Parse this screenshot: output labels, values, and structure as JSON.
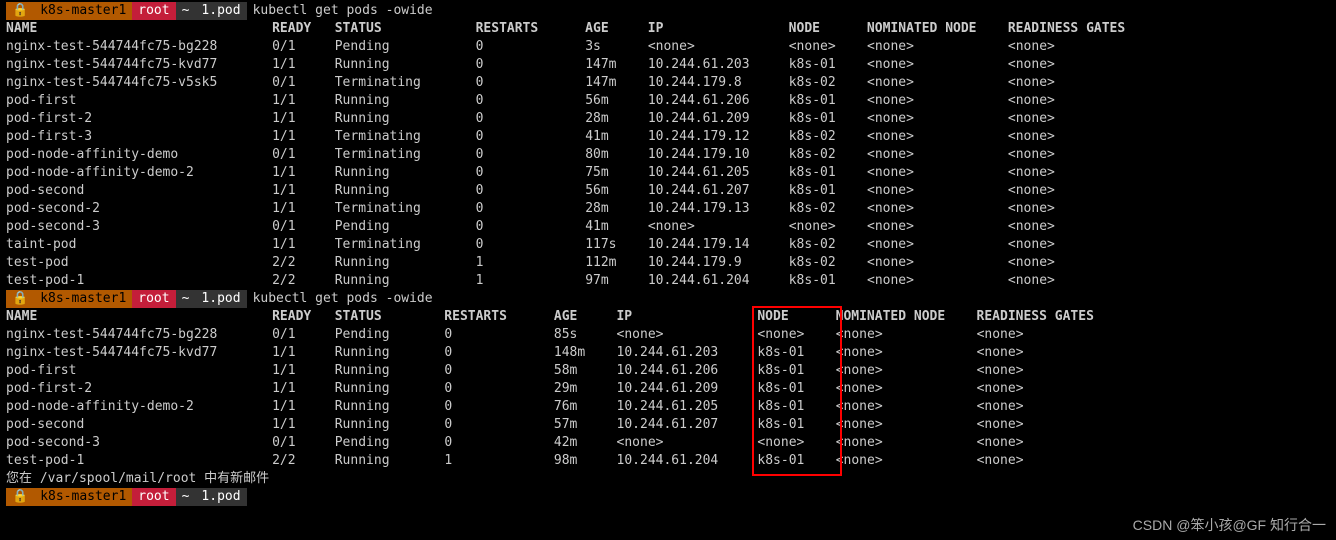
{
  "prompt": {
    "lock": "🔒",
    "host": "k8s-master1",
    "user": "root",
    "path": "~",
    "dir": "1.pod",
    "sep": "",
    "rsep": ""
  },
  "cmd1": "kubectl get pods -owide",
  "cmd2": "kubectl get pods -owide",
  "mail_msg": "您在 /var/spool/mail/root 中有新邮件",
  "cols1": {
    "w": [
      34,
      8,
      18,
      14,
      8,
      18,
      10,
      18,
      18
    ],
    "h": [
      "NAME",
      "READY",
      "STATUS",
      "RESTARTS",
      "AGE",
      "IP",
      "NODE",
      "NOMINATED NODE",
      "READINESS GATES"
    ]
  },
  "rows1": [
    [
      "nginx-test-544744fc75-bg228",
      "0/1",
      "Pending",
      "0",
      "3s",
      "<none>",
      "<none>",
      "<none>",
      "<none>"
    ],
    [
      "nginx-test-544744fc75-kvd77",
      "1/1",
      "Running",
      "0",
      "147m",
      "10.244.61.203",
      "k8s-01",
      "<none>",
      "<none>"
    ],
    [
      "nginx-test-544744fc75-v5sk5",
      "0/1",
      "Terminating",
      "0",
      "147m",
      "10.244.179.8",
      "k8s-02",
      "<none>",
      "<none>"
    ],
    [
      "pod-first",
      "1/1",
      "Running",
      "0",
      "56m",
      "10.244.61.206",
      "k8s-01",
      "<none>",
      "<none>"
    ],
    [
      "pod-first-2",
      "1/1",
      "Running",
      "0",
      "28m",
      "10.244.61.209",
      "k8s-01",
      "<none>",
      "<none>"
    ],
    [
      "pod-first-3",
      "1/1",
      "Terminating",
      "0",
      "41m",
      "10.244.179.12",
      "k8s-02",
      "<none>",
      "<none>"
    ],
    [
      "pod-node-affinity-demo",
      "0/1",
      "Terminating",
      "0",
      "80m",
      "10.244.179.10",
      "k8s-02",
      "<none>",
      "<none>"
    ],
    [
      "pod-node-affinity-demo-2",
      "1/1",
      "Running",
      "0",
      "75m",
      "10.244.61.205",
      "k8s-01",
      "<none>",
      "<none>"
    ],
    [
      "pod-second",
      "1/1",
      "Running",
      "0",
      "56m",
      "10.244.61.207",
      "k8s-01",
      "<none>",
      "<none>"
    ],
    [
      "pod-second-2",
      "1/1",
      "Terminating",
      "0",
      "28m",
      "10.244.179.13",
      "k8s-02",
      "<none>",
      "<none>"
    ],
    [
      "pod-second-3",
      "0/1",
      "Pending",
      "0",
      "41m",
      "<none>",
      "<none>",
      "<none>",
      "<none>"
    ],
    [
      "taint-pod",
      "1/1",
      "Terminating",
      "0",
      "117s",
      "10.244.179.14",
      "k8s-02",
      "<none>",
      "<none>"
    ],
    [
      "test-pod",
      "2/2",
      "Running",
      "1",
      "112m",
      "10.244.179.9",
      "k8s-02",
      "<none>",
      "<none>"
    ],
    [
      "test-pod-1",
      "2/2",
      "Running",
      "1",
      "97m",
      "10.244.61.204",
      "k8s-01",
      "<none>",
      "<none>"
    ]
  ],
  "cols2": {
    "w": [
      34,
      8,
      14,
      14,
      8,
      18,
      10,
      18,
      18
    ],
    "h": [
      "NAME",
      "READY",
      "STATUS",
      "RESTARTS",
      "AGE",
      "IP",
      "NODE",
      "NOMINATED NODE",
      "READINESS GATES"
    ]
  },
  "rows2": [
    [
      "nginx-test-544744fc75-bg228",
      "0/1",
      "Pending",
      "0",
      "85s",
      "<none>",
      "<none>",
      "<none>",
      "<none>"
    ],
    [
      "nginx-test-544744fc75-kvd77",
      "1/1",
      "Running",
      "0",
      "148m",
      "10.244.61.203",
      "k8s-01",
      "<none>",
      "<none>"
    ],
    [
      "pod-first",
      "1/1",
      "Running",
      "0",
      "58m",
      "10.244.61.206",
      "k8s-01",
      "<none>",
      "<none>"
    ],
    [
      "pod-first-2",
      "1/1",
      "Running",
      "0",
      "29m",
      "10.244.61.209",
      "k8s-01",
      "<none>",
      "<none>"
    ],
    [
      "pod-node-affinity-demo-2",
      "1/1",
      "Running",
      "0",
      "76m",
      "10.244.61.205",
      "k8s-01",
      "<none>",
      "<none>"
    ],
    [
      "pod-second",
      "1/1",
      "Running",
      "0",
      "57m",
      "10.244.61.207",
      "k8s-01",
      "<none>",
      "<none>"
    ],
    [
      "pod-second-3",
      "0/1",
      "Pending",
      "0",
      "42m",
      "<none>",
      "<none>",
      "<none>",
      "<none>"
    ],
    [
      "test-pod-1",
      "2/2",
      "Running",
      "1",
      "98m",
      "10.244.61.204",
      "k8s-01",
      "<none>",
      "<none>"
    ]
  ],
  "watermark": "CSDN @笨小孩@GF 知行合一",
  "highlight_col": "NODE"
}
